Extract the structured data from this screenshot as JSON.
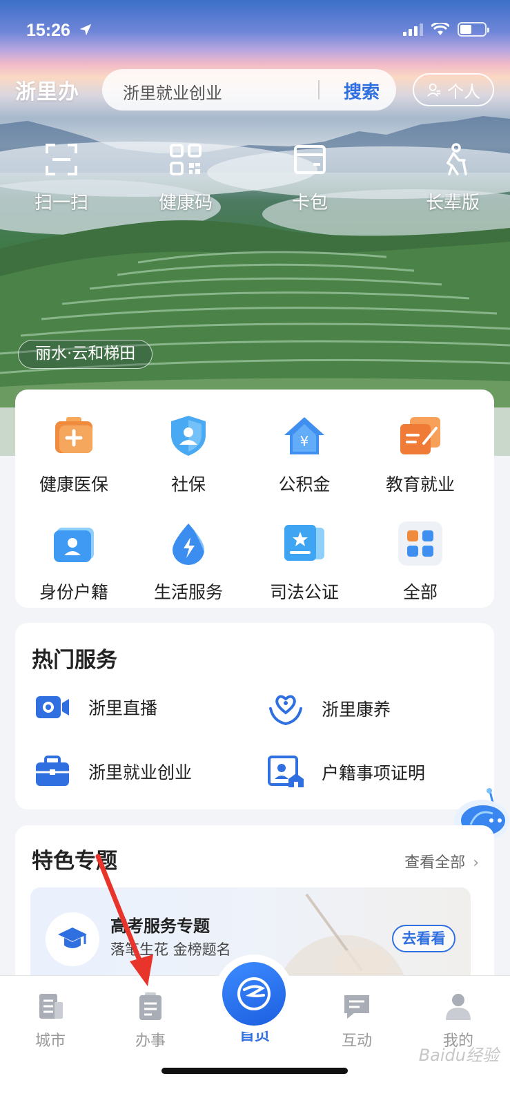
{
  "status_bar": {
    "time": "15:26"
  },
  "header": {
    "logo": "浙里办",
    "search_text": "浙里就业创业",
    "search_button": "搜索",
    "personal_button": "个人"
  },
  "quick_actions": [
    {
      "label": "扫一扫",
      "icon": "scan-icon"
    },
    {
      "label": "健康码",
      "icon": "qr-code-icon"
    },
    {
      "label": "卡包",
      "icon": "card-wallet-icon"
    },
    {
      "label": "长辈版",
      "icon": "elder-icon"
    }
  ],
  "location_tag": "丽水·云和梯田",
  "services": [
    {
      "label": "健康医保",
      "icon": "medical-kit-icon"
    },
    {
      "label": "社保",
      "icon": "social-security-shield-icon"
    },
    {
      "label": "公积金",
      "icon": "housing-fund-icon"
    },
    {
      "label": "教育就业",
      "icon": "education-icon"
    },
    {
      "label": "身份户籍",
      "icon": "id-card-icon"
    },
    {
      "label": "生活服务",
      "icon": "life-service-drop-icon"
    },
    {
      "label": "司法公证",
      "icon": "notary-folder-icon"
    },
    {
      "label": "全部",
      "icon": "all-grid-icon"
    }
  ],
  "hot_services": {
    "title": "热门服务",
    "items": [
      {
        "label": "浙里直播",
        "icon": "live-camera-icon"
      },
      {
        "label": "浙里康养",
        "icon": "heart-care-icon"
      },
      {
        "label": "浙里就业创业",
        "icon": "briefcase-icon"
      },
      {
        "label": "户籍事项证明",
        "icon": "household-cert-icon"
      }
    ]
  },
  "featured": {
    "title": "特色专题",
    "view_all": "查看全部",
    "topic_title": "高考服务专题",
    "topic_subtitle": "落笔生花 金榜题名",
    "topic_button": "去看看"
  },
  "tabs": [
    {
      "label": "城市",
      "icon": "city-icon"
    },
    {
      "label": "办事",
      "icon": "tasks-icon"
    },
    {
      "label": "首页",
      "icon": "home-logo-icon"
    },
    {
      "label": "互动",
      "icon": "chat-icon"
    },
    {
      "label": "我的",
      "icon": "user-icon"
    }
  ],
  "watermark": "Baidu经验",
  "colors": {
    "accent": "#2f6fe0",
    "annotation_arrow": "#e8342a"
  }
}
